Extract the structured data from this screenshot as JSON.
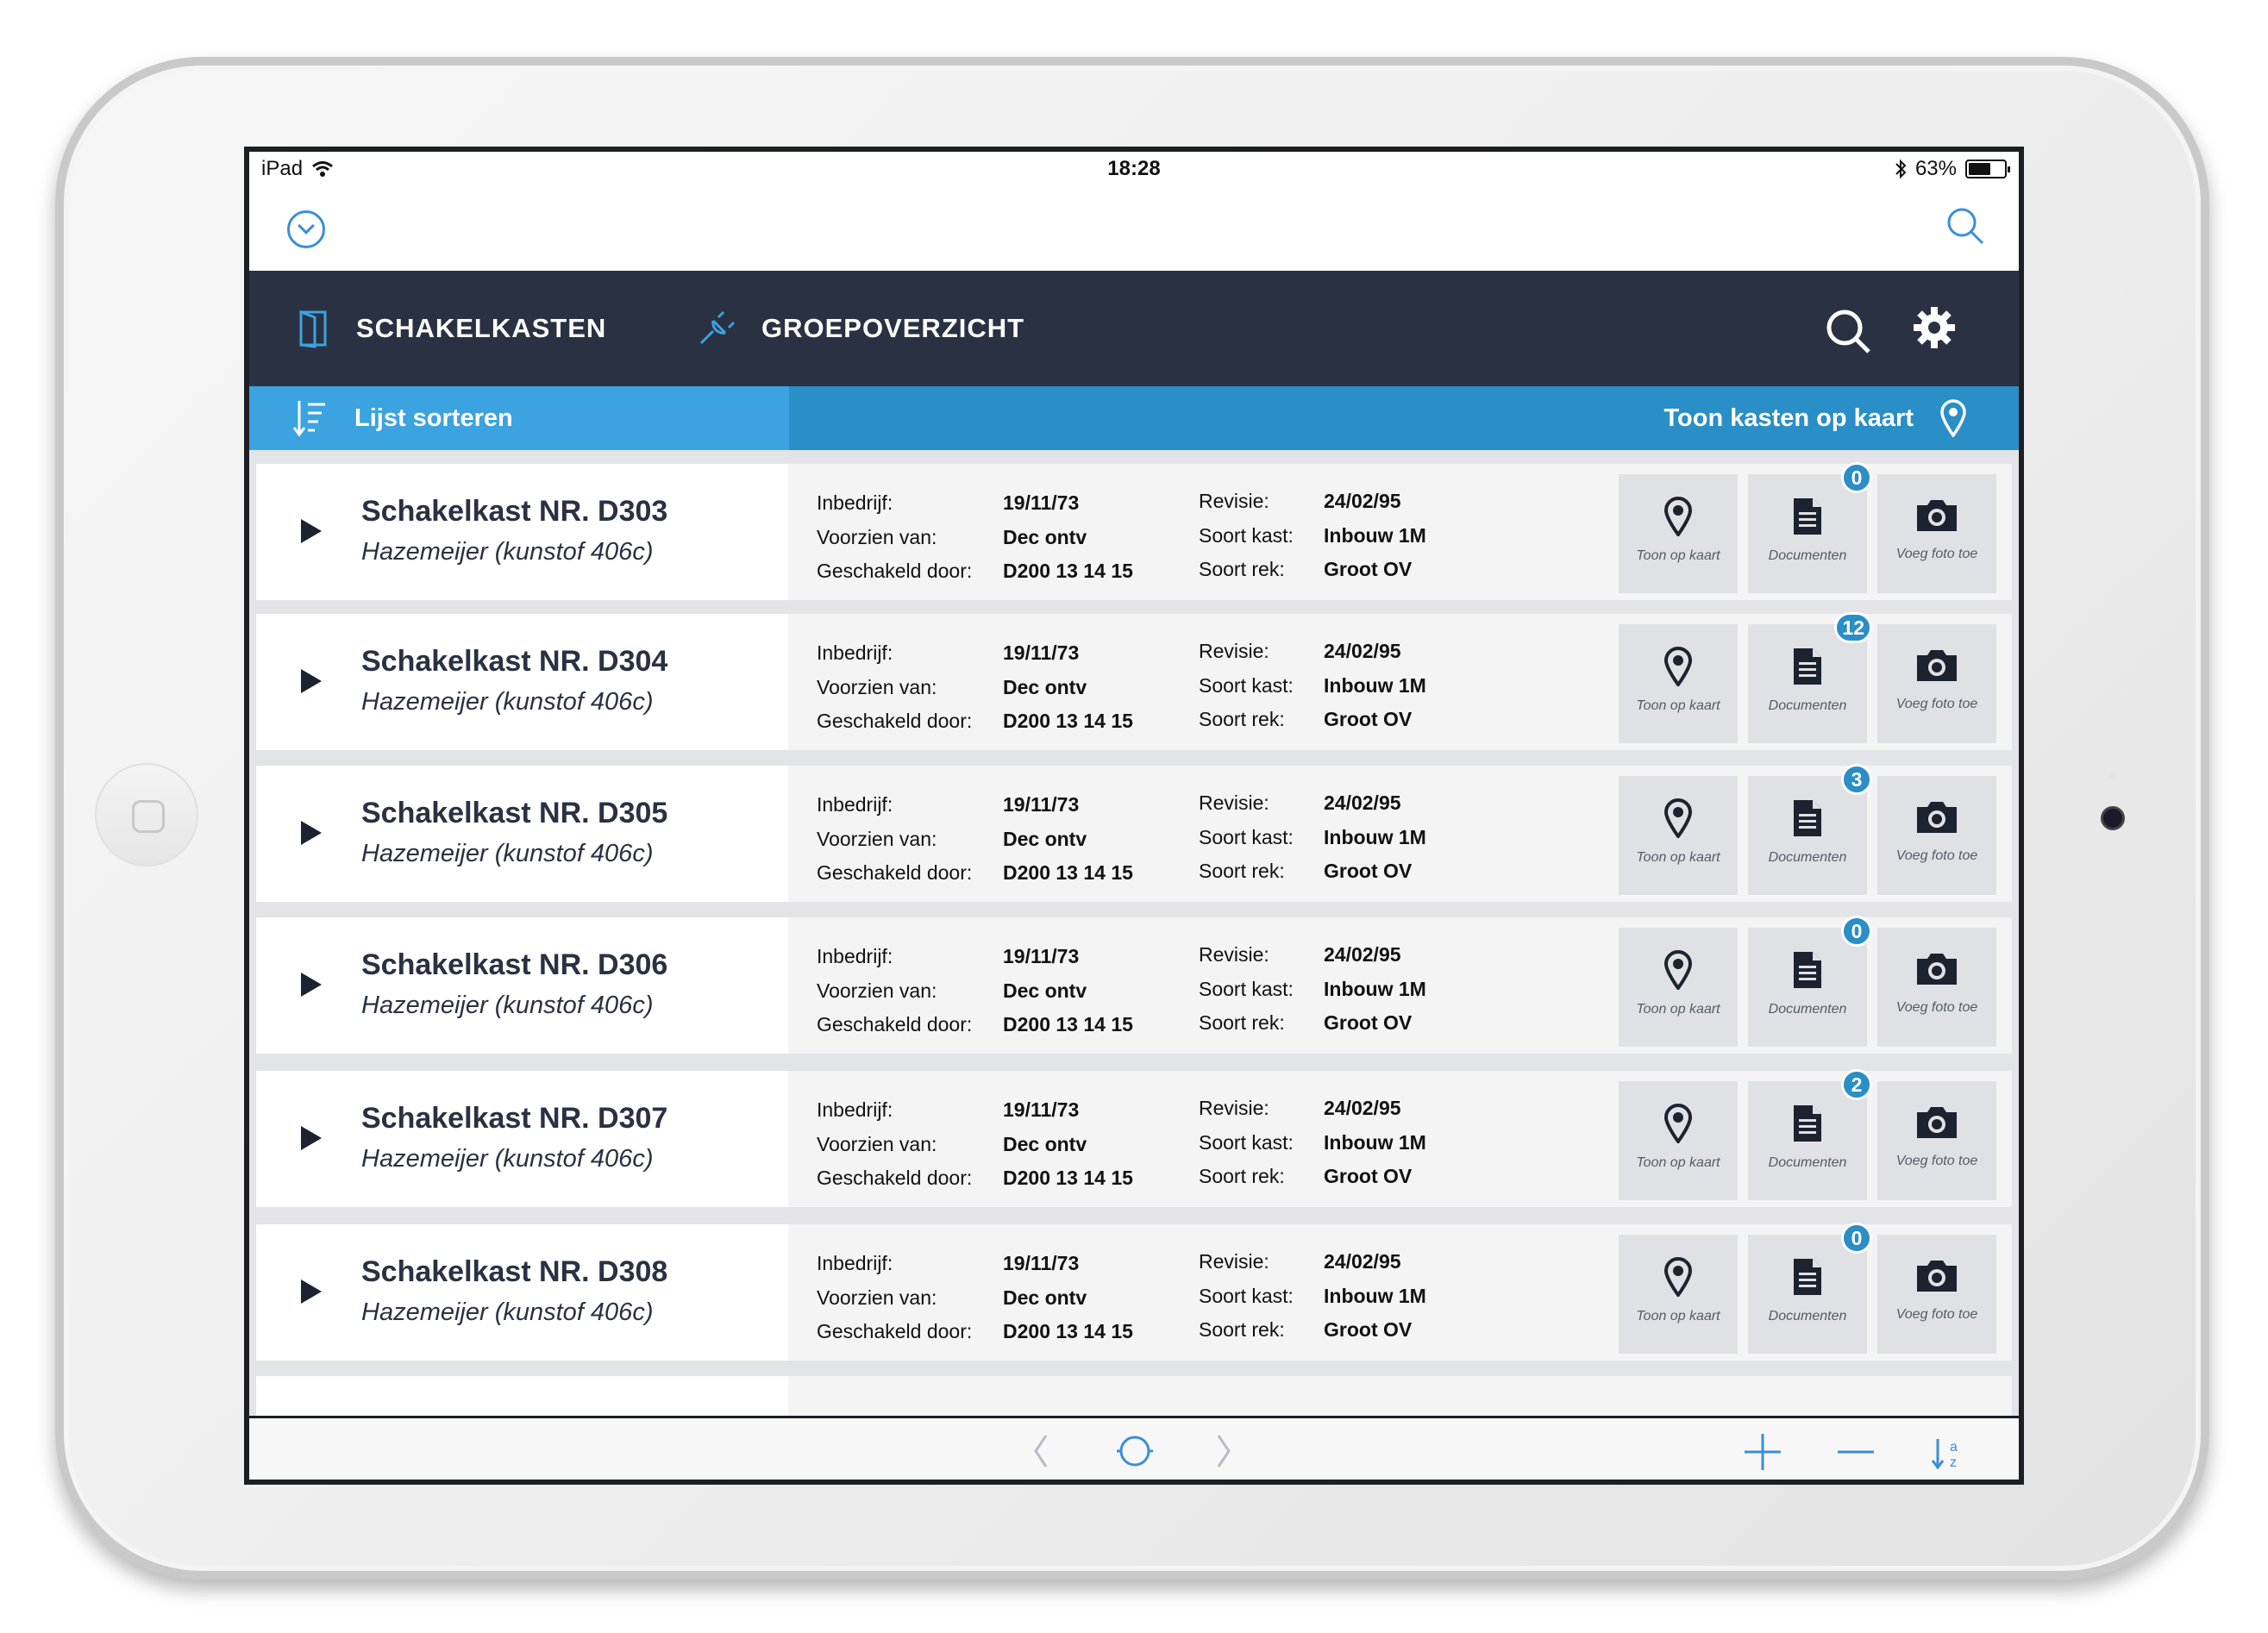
{
  "status": {
    "device": "iPad",
    "time": "18:28",
    "battery": "63%",
    "battery_level": 0.63
  },
  "nav": {
    "schakelkasten": "SCHAKELKASTEN",
    "groepoverzicht": "GROEPOVERZICHT"
  },
  "sortbar": {
    "sort_label": "Lijst sorteren",
    "map_label": "Toon kasten op kaart"
  },
  "labels": {
    "inbedrijf": "Inbedrijf:",
    "voorzien": "Voorzien van:",
    "geschakeld": "Geschakeld door:",
    "revisie": "Revisie:",
    "soort_kast": "Soort kast:",
    "soort_rek": "Soort rek:",
    "toon_op_kaart": "Toon op kaart",
    "documenten": "Documenten",
    "voeg_foto": "Voeg foto toe"
  },
  "rows": [
    {
      "title": "Schakelkast NR. D303",
      "subtitle": "Hazemeijer (kunstof 406c)",
      "inbedrijf": "19/11/73",
      "voorzien": "Dec ontv",
      "geschakeld": "D200 13 14 15",
      "revisie": "24/02/95",
      "soort_kast": "Inbouw 1M",
      "soort_rek": "Groot OV",
      "docs": "0"
    },
    {
      "title": "Schakelkast NR. D304",
      "subtitle": "Hazemeijer (kunstof 406c)",
      "inbedrijf": "19/11/73",
      "voorzien": "Dec ontv",
      "geschakeld": "D200 13 14 15",
      "revisie": "24/02/95",
      "soort_kast": "Inbouw 1M",
      "soort_rek": "Groot OV",
      "docs": "12"
    },
    {
      "title": "Schakelkast NR. D305",
      "subtitle": "Hazemeijer (kunstof 406c)",
      "inbedrijf": "19/11/73",
      "voorzien": "Dec ontv",
      "geschakeld": "D200 13 14 15",
      "revisie": "24/02/95",
      "soort_kast": "Inbouw 1M",
      "soort_rek": "Groot OV",
      "docs": "3"
    },
    {
      "title": "Schakelkast NR. D306",
      "subtitle": "Hazemeijer (kunstof 406c)",
      "inbedrijf": "19/11/73",
      "voorzien": "Dec ontv",
      "geschakeld": "D200 13 14 15",
      "revisie": "24/02/95",
      "soort_kast": "Inbouw 1M",
      "soort_rek": "Groot OV",
      "docs": "0"
    },
    {
      "title": "Schakelkast NR. D307",
      "subtitle": "Hazemeijer (kunstof 406c)",
      "inbedrijf": "19/11/73",
      "voorzien": "Dec ontv",
      "geschakeld": "D200 13 14 15",
      "revisie": "24/02/95",
      "soort_kast": "Inbouw 1M",
      "soort_rek": "Groot OV",
      "docs": "2"
    },
    {
      "title": "Schakelkast NR. D308",
      "subtitle": "Hazemeijer (kunstof 406c)",
      "inbedrijf": "19/11/73",
      "voorzien": "Dec ontv",
      "geschakeld": "D200 13 14 15",
      "revisie": "24/02/95",
      "soort_kast": "Inbouw 1M",
      "soort_rek": "Groot OV",
      "docs": "0"
    }
  ],
  "icons": {
    "wifi": "wifi-icon",
    "bluetooth": "bluetooth-icon",
    "dropdown": "chevron-down-icon",
    "search": "search-icon",
    "door": "door-icon",
    "plug": "plug-icon",
    "gear": "gear-icon",
    "sort": "sort-icon",
    "pin": "map-pin-icon",
    "document": "document-icon",
    "camera": "camera-icon",
    "play": "play-icon",
    "back": "chevron-left-icon",
    "forward": "chevron-right-icon",
    "home": "circle-icon",
    "add": "plus-icon",
    "remove": "minus-icon",
    "sort_az": "sort-az-icon"
  },
  "colors": {
    "nav_bg": "#2a3142",
    "accent": "#2a8ec7",
    "accent_light": "#3ba3e0",
    "ios_blue": "#3a8fd6"
  }
}
